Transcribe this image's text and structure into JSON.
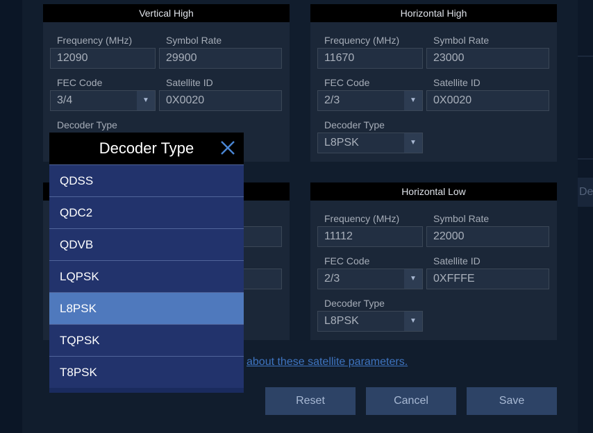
{
  "panels": {
    "vertical_high": {
      "title": "Vertical High",
      "frequency_label": "Frequency (MHz)",
      "frequency_value": "12090",
      "symbol_rate_label": "Symbol Rate",
      "symbol_rate_value": "29900",
      "fec_label": "FEC Code",
      "fec_value": "3/4",
      "satellite_label": "Satellite ID",
      "satellite_value": "0X0020",
      "decoder_label": "Decoder Type"
    },
    "horizontal_high": {
      "title": "Horizontal High",
      "frequency_label": "Frequency (MHz)",
      "frequency_value": "11670",
      "symbol_rate_label": "Symbol Rate",
      "symbol_rate_value": "23000",
      "fec_label": "FEC Code",
      "fec_value": "2/3",
      "satellite_label": "Satellite ID",
      "satellite_value": "0X0020",
      "decoder_label": "Decoder Type",
      "decoder_value": "L8PSK"
    },
    "horizontal_low": {
      "title": "Horizontal Low",
      "frequency_label": "Frequency (MHz)",
      "frequency_value": "11112",
      "symbol_rate_label": "Symbol Rate",
      "symbol_rate_value": "22000",
      "fec_label": "FEC Code",
      "fec_value": "2/3",
      "satellite_label": "Satellite ID",
      "satellite_value": "0XFFFE",
      "decoder_label": "Decoder Type",
      "decoder_value": "L8PSK"
    }
  },
  "help_link_text": "about these satellite parameters.",
  "buttons": {
    "reset": "Reset",
    "cancel": "Cancel",
    "save": "Save"
  },
  "side_tab_text": "De",
  "modal": {
    "title": "Decoder Type",
    "selected_value": "L8PSK",
    "options": [
      "QDSS",
      "QDC2",
      "QDVB",
      "LQPSK",
      "L8PSK",
      "TQPSK",
      "T8PSK"
    ]
  },
  "icons": {
    "dropdown": "chevron-down-icon",
    "close": "close-icon"
  },
  "colors": {
    "selected_option": "#4f79bd",
    "option_bg": "#22336c",
    "button_bg": "#2d4366",
    "link": "#3e74c0"
  }
}
